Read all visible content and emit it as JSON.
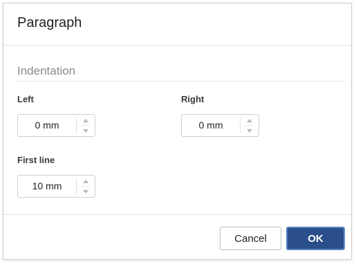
{
  "dialog": {
    "title": "Paragraph"
  },
  "indentation": {
    "heading": "Indentation",
    "left": {
      "label": "Left",
      "value": "0 mm"
    },
    "right": {
      "label": "Right",
      "value": "0 mm"
    },
    "first_line": {
      "label": "First line",
      "value": "10 mm"
    }
  },
  "footer": {
    "cancel_label": "Cancel",
    "ok_label": "OK"
  },
  "colors": {
    "primary_button": "#2b4f8a",
    "primary_button_border": "#5b86c8"
  },
  "icons": {
    "increment": "caret-up-icon",
    "decrement": "caret-down-icon"
  }
}
